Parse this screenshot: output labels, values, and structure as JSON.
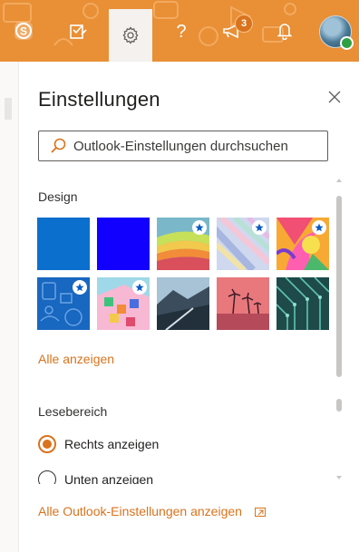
{
  "topbar": {
    "color": "#e98f36",
    "icons": [
      "skype-icon",
      "todo-icon",
      "gear-icon",
      "help-icon",
      "megaphone-icon",
      "bell-icon"
    ],
    "badge_count": "3"
  },
  "panel": {
    "title": "Einstellungen",
    "search_placeholder": "Outlook-Einstellungen durchsuchen"
  },
  "design": {
    "label": "Design",
    "themes": [
      {
        "name": "blue",
        "color": "#0b6fce",
        "premium": false
      },
      {
        "name": "dark-blue",
        "color": "#1200ff",
        "premium": false
      },
      {
        "name": "rainbow-waves",
        "premium": true
      },
      {
        "name": "pastel-lines",
        "premium": true
      },
      {
        "name": "colorful-dragon",
        "premium": true
      },
      {
        "name": "blueprint",
        "premium": true
      },
      {
        "name": "pixel-garden",
        "premium": true
      },
      {
        "name": "mountain-road",
        "premium": false
      },
      {
        "name": "palm-sunset",
        "premium": false
      },
      {
        "name": "circuit-board",
        "premium": false
      }
    ],
    "see_all": "Alle anzeigen"
  },
  "reading_pane": {
    "label": "Lesebereich",
    "options": [
      {
        "label": "Rechts anzeigen",
        "selected": true
      },
      {
        "label": "Unten anzeigen",
        "selected": false
      }
    ]
  },
  "footer": {
    "all_settings": "Alle Outlook-Einstellungen anzeigen"
  },
  "colors": {
    "accent": "#d9731d",
    "topbar": "#e98f36"
  }
}
